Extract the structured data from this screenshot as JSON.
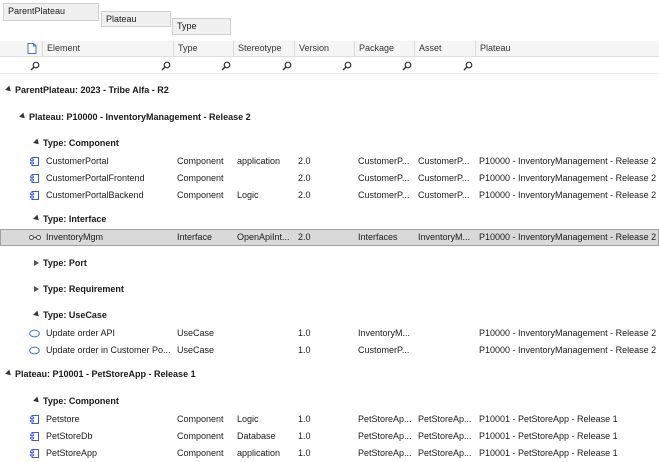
{
  "group_by": [
    "ParentPlateau",
    "Plateau",
    "Type"
  ],
  "columns": [
    "",
    "Element",
    "Type",
    "Stereotype",
    "Version",
    "Package",
    "Asset",
    "Plateau"
  ],
  "groups": {
    "parent": "ParentPlateau: 2023 - Tribe Alfa  - R2",
    "plateau1": "Plateau: P10000 - InventoryManagement - Release 2",
    "plateau2": "Plateau: P10001 - PetStoreApp - Release 1",
    "t_component": "Type: Component",
    "t_interface": "Type: Interface",
    "t_port": "Type: Port",
    "t_requirement": "Type: Requirement",
    "t_usecase": "Type: UseCase",
    "t_component2": "Type: Component"
  },
  "rows": {
    "r1": {
      "element": "CustomerPortal",
      "type": "Component",
      "stereotype": "application",
      "version": "2.0",
      "package": "CustomerP...",
      "asset": "CustomerP...",
      "plateau": "P10000 - InventoryManagement - Release 2"
    },
    "r2": {
      "element": "CustomerPortalFrontend",
      "type": "Component",
      "stereotype": "",
      "version": "2.0",
      "package": "CustomerP...",
      "asset": "CustomerP...",
      "plateau": "P10000 - InventoryManagement - Release 2"
    },
    "r3": {
      "element": "CustomerPortalBackend",
      "type": "Component",
      "stereotype": "Logic",
      "version": "2.0",
      "package": "CustomerP...",
      "asset": "CustomerP...",
      "plateau": "P10000 - InventoryManagement - Release 2"
    },
    "r4": {
      "element": "InventoryMgm",
      "type": "Interface",
      "stereotype": "OpenApiInt...",
      "version": "2.0",
      "package": "Interfaces",
      "asset": "InventoryM...",
      "plateau": "P10000 - InventoryManagement - Release 2"
    },
    "r5": {
      "element": "Update order API",
      "type": "UseCase",
      "stereotype": "",
      "version": "1.0",
      "package": "InventoryM...",
      "asset": "",
      "plateau": "P10000 - InventoryManagement - Release 2"
    },
    "r6": {
      "element": "Update order in Customer Po...",
      "type": "UseCase",
      "stereotype": "",
      "version": "1.0",
      "package": "CustomerP...",
      "asset": "",
      "plateau": "P10000 - InventoryManagement - Release 2"
    },
    "r7": {
      "element": "Petstore",
      "type": "Component",
      "stereotype": "Logic",
      "version": "1.0",
      "package": "PetStoreAp...",
      "asset": "PetStoreAp...",
      "plateau": "P10001 - PetStoreApp - Release 1"
    },
    "r8": {
      "element": "PetStoreDb",
      "type": "Component",
      "stereotype": "Database",
      "version": "1.0",
      "package": "PetStoreAp...",
      "asset": "PetStoreAp...",
      "plateau": "P10001 - PetStoreApp - Release 1"
    },
    "r9": {
      "element": "PetStoreApp",
      "type": "Component",
      "stereotype": "application",
      "version": "1.0",
      "package": "PetStoreAp...",
      "asset": "PetStoreAp...",
      "plateau": "P10001 - PetStoreApp - Release 1"
    }
  },
  "colors": {
    "selected_row": "#d9d9d9",
    "component_icon": "#3b5bdb",
    "usecase_icon": "#4a6fd8"
  },
  "icons": {
    "doc_header": "document-icon",
    "filter": "search-icon",
    "component": "component-icon",
    "interface": "interface-icon",
    "usecase": "usecase-icon"
  }
}
